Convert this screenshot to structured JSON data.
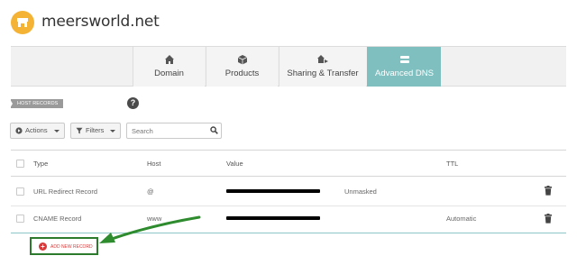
{
  "header": {
    "site_name": "meersworld.net",
    "logo_icon": "storefront-icon",
    "logo_color": "#f5b335"
  },
  "tabs": [
    {
      "label": "Domain",
      "icon": "home-icon",
      "active": false
    },
    {
      "label": "Products",
      "icon": "box-icon",
      "active": false
    },
    {
      "label": "Sharing & Transfer",
      "icon": "share-icon",
      "active": false
    },
    {
      "label": "Advanced DNS",
      "icon": "server-icon",
      "active": true
    }
  ],
  "section": {
    "title": "HOST RECORDS",
    "help_label": "?"
  },
  "toolbar": {
    "actions_label": "Actions",
    "filters_label": "Filters",
    "search_placeholder": "Search"
  },
  "table": {
    "columns": [
      "Type",
      "Host",
      "Value",
      "TTL"
    ],
    "rows": [
      {
        "type": "URL Redirect Record",
        "host": "@",
        "value": "[redacted]",
        "extra": "Unmasked",
        "ttl": ""
      },
      {
        "type": "CNAME Record",
        "host": "www",
        "value": "[redacted]",
        "extra": "",
        "ttl": "Automatic"
      }
    ]
  },
  "add_record": {
    "label": "ADD NEW RECORD"
  },
  "colors": {
    "active_tab": "#7fbfbf",
    "add_record_text": "#d73a3a",
    "highlight_border": "#2c7a2c"
  }
}
